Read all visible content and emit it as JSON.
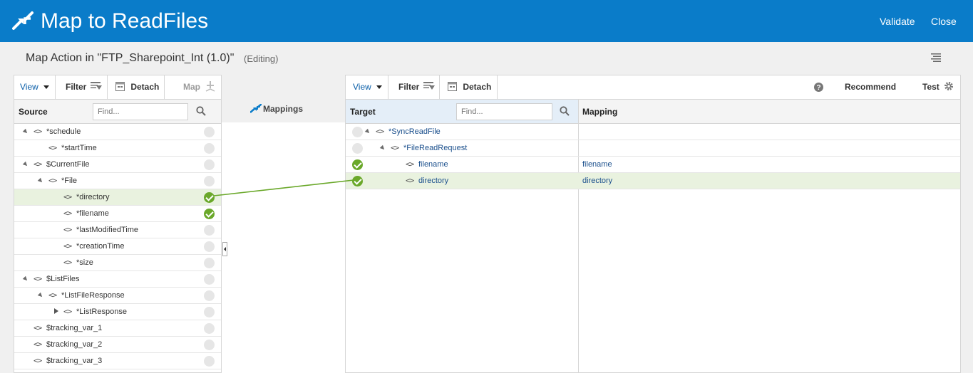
{
  "header": {
    "title": "Map to ReadFiles",
    "validate_label": "Validate",
    "close_label": "Close",
    "logo_icon": "map-arrows-icon",
    "bg_color": "#0a7cc9"
  },
  "subheader": {
    "title": "Map Action in \"FTP_Sharepoint_Int (1.0)\"",
    "status": "(Editing)",
    "menu_icon": "hamburger-menu-icon"
  },
  "source": {
    "toolbar": {
      "view": "View",
      "filter": "Filter",
      "detach": "Detach",
      "map": "Map"
    },
    "column_label": "Source",
    "find_placeholder": "Find...",
    "rows": [
      {
        "label": "*schedule",
        "mapped": false
      },
      {
        "label": "*startTime",
        "mapped": false
      },
      {
        "label": "$CurrentFile",
        "mapped": false
      },
      {
        "label": "*File",
        "mapped": false
      },
      {
        "label": "*directory",
        "mapped": true,
        "selected": true
      },
      {
        "label": "*filename",
        "mapped": true
      },
      {
        "label": "*lastModifiedTime",
        "mapped": false
      },
      {
        "label": "*creationTime",
        "mapped": false
      },
      {
        "label": "*size",
        "mapped": false
      },
      {
        "label": "$ListFiles",
        "mapped": false
      },
      {
        "label": "*ListFileResponse",
        "mapped": false
      },
      {
        "label": "*ListResponse",
        "mapped": false
      },
      {
        "label": "$tracking_var_1",
        "mapped": false
      },
      {
        "label": "$tracking_var_2",
        "mapped": false
      },
      {
        "label": "$tracking_var_3",
        "mapped": false
      }
    ]
  },
  "middle": {
    "label": "Mappings"
  },
  "target": {
    "toolbar": {
      "view": "View",
      "filter": "Filter",
      "detach": "Detach",
      "recommend": "Recommend",
      "test": "Test"
    },
    "column_label": "Target",
    "mapping_column_label": "Mapping",
    "find_placeholder": "Find...",
    "rows": [
      {
        "label": "*SyncReadFile",
        "mapped": false,
        "mapping": ""
      },
      {
        "label": "*FileReadRequest",
        "mapped": false,
        "mapping": ""
      },
      {
        "label": "filename",
        "mapped": true,
        "mapping": "filename"
      },
      {
        "label": "directory",
        "mapped": true,
        "mapping": "directory",
        "selected": true
      }
    ]
  },
  "colors": {
    "mapped": "#6aa82a",
    "selected_row": "#e9f2df",
    "link": "#6aa82a"
  }
}
